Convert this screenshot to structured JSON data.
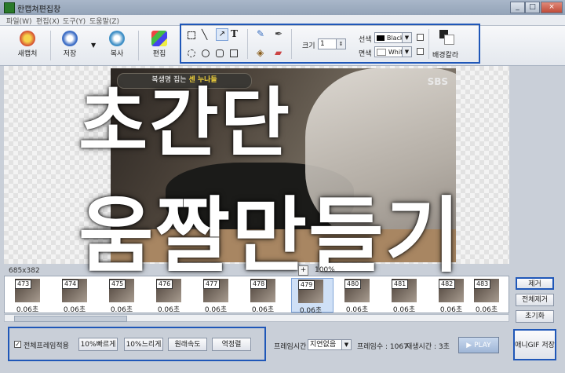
{
  "window": {
    "title": "한캡쳐편집창",
    "controls": {
      "min": "_",
      "max": "□",
      "close": "×"
    }
  },
  "menu": [
    "파일(W)",
    "편집(X)",
    "도구(Y)",
    "도움말(Z)"
  ],
  "toolbar": {
    "new_capture": "새캡처",
    "save": "저장",
    "copy": "복사",
    "edit": "편집",
    "text_tool": "T",
    "size_label": "크기",
    "size_value": "1",
    "line_label": "선색",
    "line_color": "Black",
    "fill_label": "면색",
    "fill_color": "White",
    "bg_color": "배경칼라"
  },
  "overlay": {
    "line1": "초간단",
    "line2": "움짤만들기"
  },
  "photo": {
    "caption_prefix": "복생명 집는",
    "caption_highlight": "센 누나들",
    "logo": "SBS"
  },
  "canvas": {
    "dimensions": "685x382",
    "zoom": "100%",
    "zoom_plus": "+"
  },
  "frames": [
    {
      "num": "473",
      "dur": "0.06초"
    },
    {
      "num": "474",
      "dur": "0.06초"
    },
    {
      "num": "475",
      "dur": "0.06초"
    },
    {
      "num": "476",
      "dur": "0.06초"
    },
    {
      "num": "477",
      "dur": "0.06초"
    },
    {
      "num": "478",
      "dur": "0.06초"
    },
    {
      "num": "479",
      "dur": "0.06초"
    },
    {
      "num": "480",
      "dur": "0.06초"
    },
    {
      "num": "481",
      "dur": "0.06초"
    },
    {
      "num": "482",
      "dur": "0.06초"
    },
    {
      "num": "483",
      "dur": "0.06초"
    }
  ],
  "side": {
    "remove": "제거",
    "remove_all": "전체제거",
    "reset": "초기화"
  },
  "options": {
    "apply_all_label": "전체프레임적용",
    "apply_all_checked": true,
    "faster": "10%빠르게",
    "slower": "10%느리게",
    "original_speed": "원래속도",
    "reverse": "역정렬"
  },
  "frame_time": {
    "label": "프레임시간",
    "value": "지연없음"
  },
  "status": {
    "frame_count": "프레임수 : 1067",
    "play_time": "재생시간 : 3초"
  },
  "play": "▶ PLAY",
  "save_gif": "애니GIF 저장",
  "colors": {
    "accent_border": "#1f57b8",
    "overlay_text": "#ffffff"
  }
}
